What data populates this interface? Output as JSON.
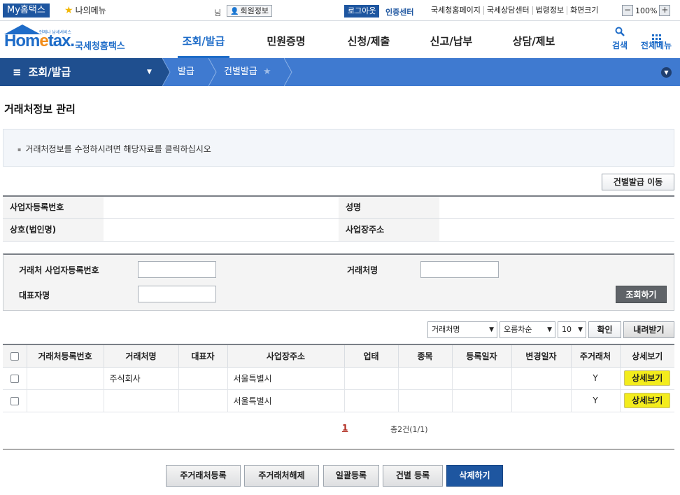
{
  "topbar": {
    "my_home": "My홈택스",
    "my_menu": "나의메뉴",
    "name_suffix": "님",
    "member_info": "회원정보",
    "logout": "로그아웃",
    "cert_center": "인증센터",
    "links": [
      "국세청홈페이지",
      "국세상담센터",
      "법령정보",
      "화면크기"
    ],
    "zoom_minus": "−",
    "zoom_level": "100%",
    "zoom_plus": "+"
  },
  "header": {
    "logo_small": "언제나 납세서비스",
    "logo_word_a": "Hom",
    "logo_word_e": "e",
    "logo_word_b": "tax.",
    "logo_brand": "국세청홈택스",
    "nav": [
      "조회/발급",
      "민원증명",
      "신청/제출",
      "신고/납부",
      "상담/제보"
    ],
    "search_label": "검색",
    "all_menu_label": "전체메뉴"
  },
  "subnav": {
    "section": "조회/발급",
    "crumbs": [
      "발급",
      "건별발급"
    ]
  },
  "page": {
    "title": "거래처정보 관리",
    "notice": "거래처정보를 수정하시려면 해당자료를 클릭하십시오",
    "move_button": "건별발급 이동"
  },
  "info": {
    "biz_no_label": "사업자등록번호",
    "name_label": "성명",
    "company_label": "상호(법인명)",
    "address_label": "사업장주소"
  },
  "search": {
    "partner_biz_no_label": "거래처 사업자등록번호",
    "partner_name_label": "거래처명",
    "ceo_label": "대표자명",
    "search_button": "조회하기"
  },
  "controls": {
    "sort_field": "거래처명",
    "sort_order": "오름차순",
    "page_size": "10",
    "confirm": "확인",
    "download": "내려받기"
  },
  "table": {
    "columns": [
      "거래처등록번호",
      "거래처명",
      "대표자",
      "사업장주소",
      "업태",
      "종목",
      "등록일자",
      "변경일자",
      "주거래처",
      "상세보기"
    ],
    "rows": [
      {
        "reg_no": "",
        "name": "주식회사",
        "ceo": "",
        "address": "서울특별시",
        "biz_type": "",
        "item": "",
        "reg_date": "",
        "mod_date": "",
        "main": "Y",
        "detail": "상세보기"
      },
      {
        "reg_no": "",
        "name": "",
        "ceo": "",
        "address": "서울특별시",
        "biz_type": "",
        "item": "",
        "reg_date": "",
        "mod_date": "",
        "main": "Y",
        "detail": "상세보기"
      }
    ]
  },
  "pagination": {
    "current": "1",
    "total": "총2건(1/1)"
  },
  "bottom_buttons": [
    "주거래처등록",
    "주거래처해제",
    "일괄등록",
    "건별 등록",
    "삭제하기"
  ],
  "colors": {
    "brand_blue": "#1e56a0",
    "subnav_blue": "#3f7ad0",
    "highlight_yellow": "#f3ec1c"
  }
}
